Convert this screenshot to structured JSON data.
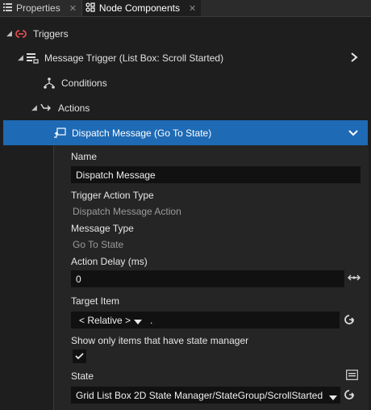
{
  "tabs": [
    {
      "label": "Properties",
      "close": "✕"
    },
    {
      "label": "Node Components",
      "close": "✕"
    }
  ],
  "tree": {
    "triggers": "Triggers",
    "message_trigger": "Message Trigger (List Box: Scroll Started)",
    "conditions": "Conditions",
    "actions": "Actions",
    "dispatch": "Dispatch Message (Go To State)"
  },
  "details": {
    "name_label": "Name",
    "name_value": "Dispatch Message",
    "trigger_action_type_label": "Trigger Action Type",
    "trigger_action_type_value": "Dispatch Message Action",
    "message_type_label": "Message Type",
    "message_type_value": "Go To State",
    "action_delay_label": "Action Delay (ms)",
    "action_delay_value": "0",
    "target_item_label": "Target Item",
    "target_item_selector": "< Relative >",
    "target_item_path": ".",
    "show_only_label": "Show only items that have state manager",
    "show_only_checked": true,
    "state_label": "State",
    "state_value": "Grid List Box 2D State Manager/StateGroup/ScrollStarted"
  },
  "colors": {
    "selection": "#1e6ab5",
    "trigger_icon": "#e05050"
  }
}
